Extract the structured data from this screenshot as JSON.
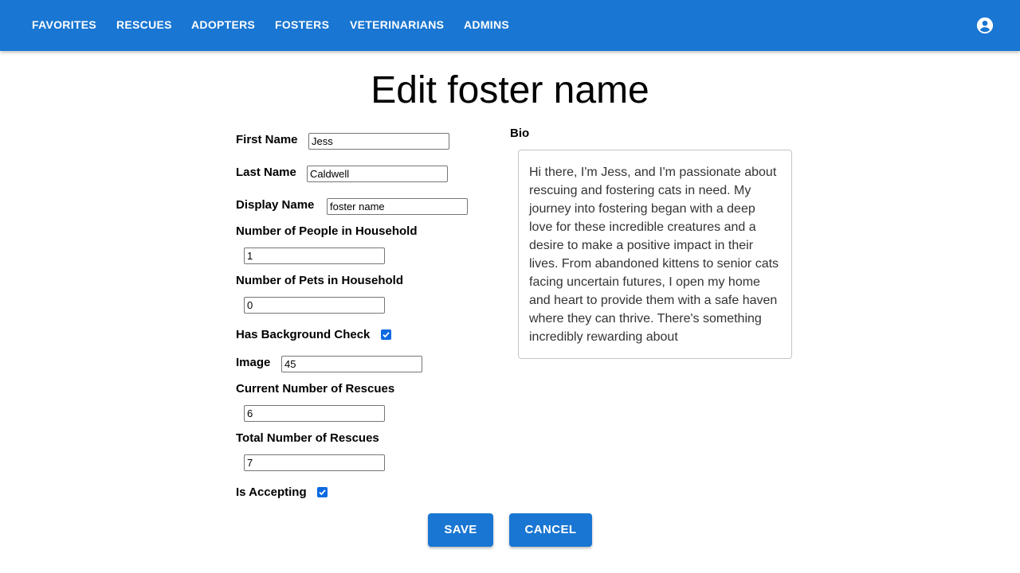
{
  "nav": {
    "items": [
      {
        "label": "FAVORITES"
      },
      {
        "label": "RESCUES"
      },
      {
        "label": "ADOPTERS"
      },
      {
        "label": "FOSTERS"
      },
      {
        "label": "VETERINARIANS"
      },
      {
        "label": "ADMINS"
      }
    ],
    "account_icon": "account-circle-icon"
  },
  "page": {
    "title": "Edit foster name"
  },
  "form": {
    "first_name": {
      "label": "First Name",
      "value": "Jess"
    },
    "last_name": {
      "label": "Last Name",
      "value": "Caldwell"
    },
    "display_name": {
      "label": "Display Name",
      "value": "foster name"
    },
    "people_in_household": {
      "label": "Number of People in Household",
      "value": "1"
    },
    "pets_in_household": {
      "label": "Number of Pets in Household",
      "value": "0"
    },
    "background_check": {
      "label": "Has Background Check",
      "checked": true
    },
    "image": {
      "label": "Image",
      "value": "45"
    },
    "current_rescues": {
      "label": "Current Number of Rescues",
      "value": "6"
    },
    "total_rescues": {
      "label": "Total Number of Rescues",
      "value": "7"
    },
    "is_accepting": {
      "label": "Is Accepting",
      "checked": true
    },
    "bio": {
      "label": "Bio",
      "value": "Hi there, I'm Jess, and I'm passionate about rescuing and fostering cats in need. My journey into fostering began with a deep love for these incredible creatures and a desire to make a positive impact in their lives. From abandoned kittens to senior cats facing uncertain futures, I open my home and heart to provide them with a safe haven where they can thrive. There's something incredibly rewarding about"
    }
  },
  "actions": {
    "save_label": "SAVE",
    "cancel_label": "CANCEL"
  },
  "colors": {
    "primary": "#1976d2",
    "checkbox": "#0b69e3"
  }
}
